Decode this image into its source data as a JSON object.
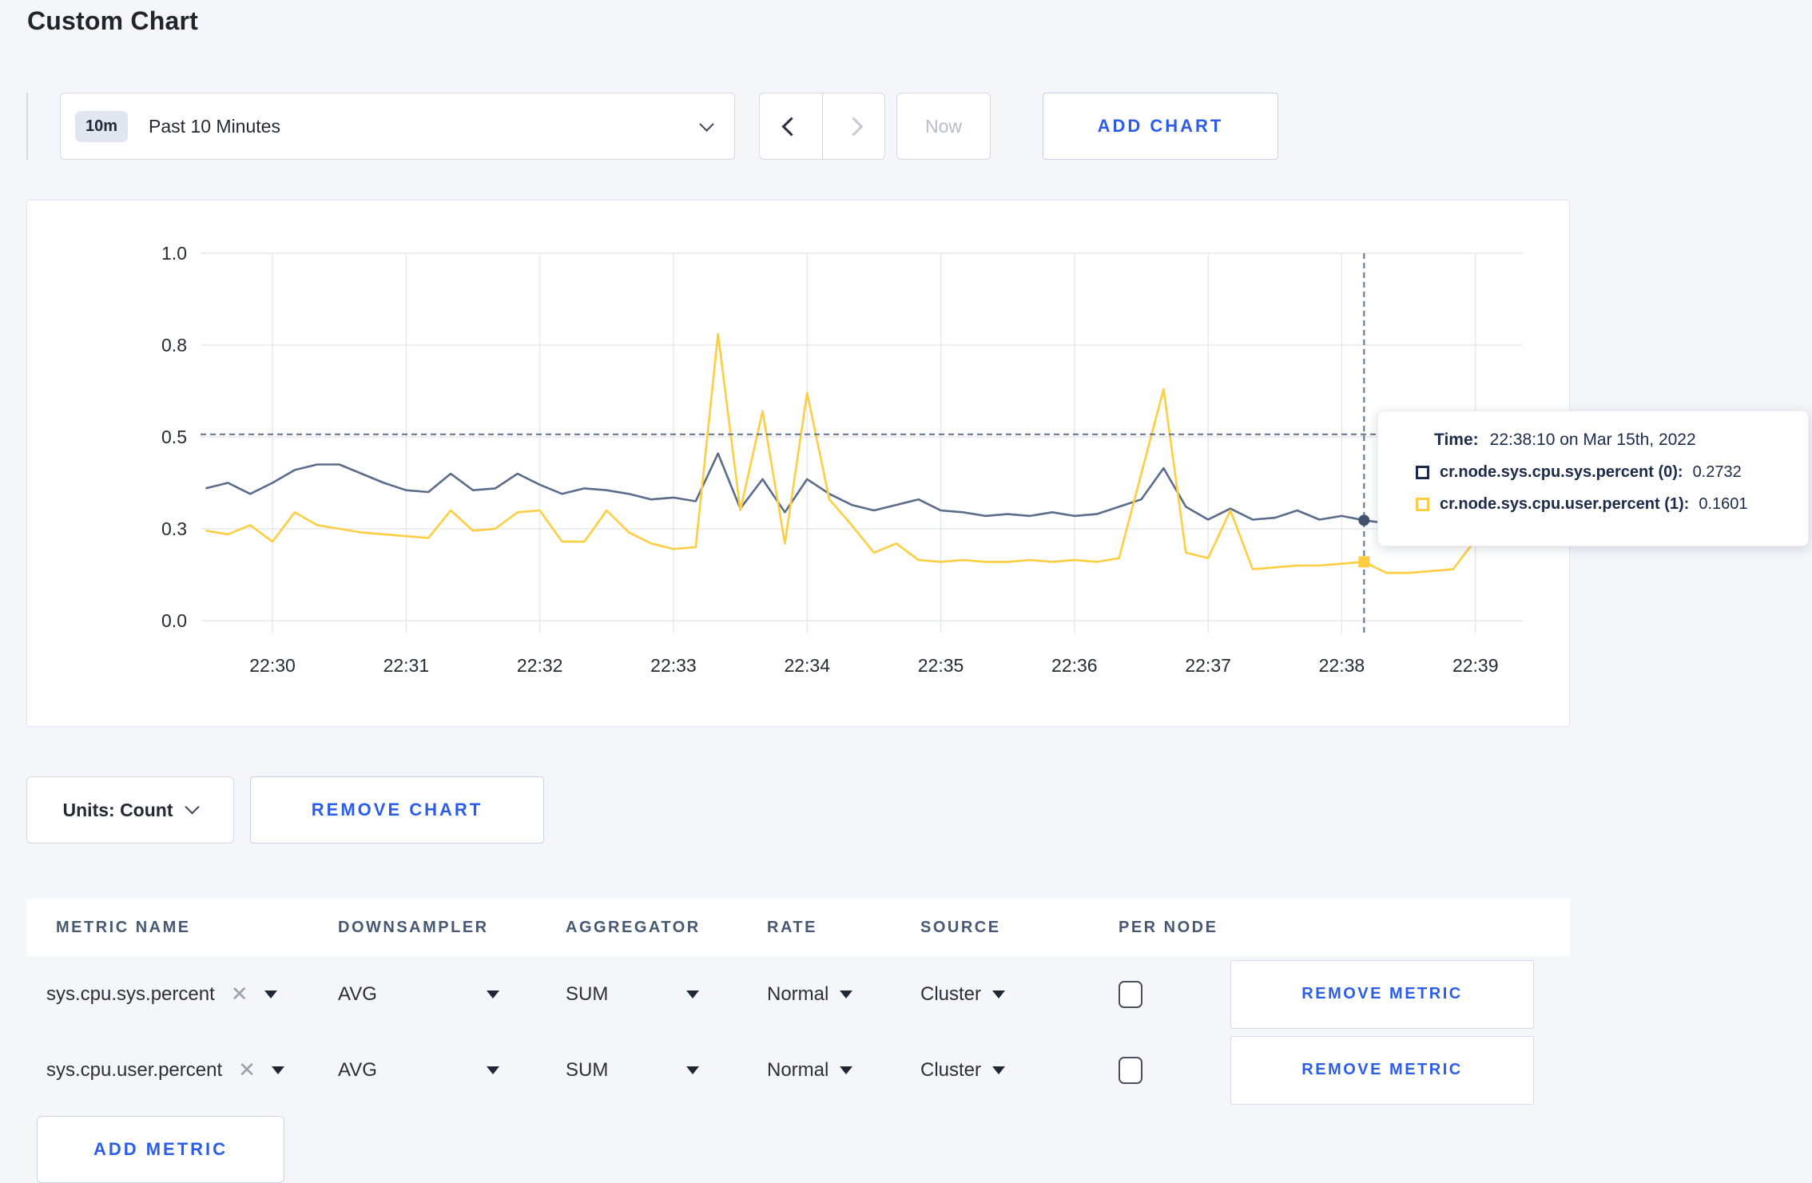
{
  "page": {
    "title": "Custom Chart"
  },
  "toolbar": {
    "time_badge": "10m",
    "time_label": "Past 10 Minutes",
    "now_label": "Now",
    "add_chart_label": "ADD CHART"
  },
  "chart_data": {
    "type": "line",
    "x_ticks": [
      "22:30",
      "22:31",
      "22:32",
      "22:33",
      "22:34",
      "22:35",
      "22:36",
      "22:37",
      "22:38",
      "22:39"
    ],
    "y_tick_labels": [
      "0.0",
      "0.3",
      "0.5",
      "0.8",
      "1.0"
    ],
    "y_tick_values": [
      0,
      0.25,
      0.5,
      0.75,
      1.0
    ],
    "ylim": [
      0,
      1
    ],
    "x_start": "22:29:30",
    "x_step_seconds": 10,
    "grid": true,
    "series": [
      {
        "name": "cr.node.sys.cpu.sys.percent",
        "color": "#5b6c8a",
        "values": [
          0.36,
          0.375,
          0.345,
          0.375,
          0.41,
          0.425,
          0.425,
          0.4,
          0.375,
          0.355,
          0.35,
          0.4,
          0.355,
          0.36,
          0.4,
          0.37,
          0.345,
          0.36,
          0.355,
          0.345,
          0.33,
          0.335,
          0.325,
          0.455,
          0.305,
          0.385,
          0.295,
          0.385,
          0.345,
          0.315,
          0.3,
          0.315,
          0.33,
          0.3,
          0.295,
          0.285,
          0.29,
          0.285,
          0.295,
          0.285,
          0.29,
          0.31,
          0.33,
          0.415,
          0.31,
          0.275,
          0.305,
          0.275,
          0.28,
          0.3,
          0.275,
          0.285,
          0.2732,
          0.265,
          0.27,
          0.28,
          0.285,
          0.29,
          0.295,
          0.3
        ]
      },
      {
        "name": "cr.node.sys.cpu.user.percent",
        "color": "#ffcd40",
        "values": [
          0.245,
          0.235,
          0.26,
          0.215,
          0.295,
          0.26,
          0.25,
          0.24,
          0.235,
          0.23,
          0.225,
          0.3,
          0.245,
          0.25,
          0.295,
          0.3,
          0.215,
          0.215,
          0.3,
          0.24,
          0.21,
          0.195,
          0.2,
          0.78,
          0.3,
          0.57,
          0.21,
          0.62,
          0.33,
          0.26,
          0.185,
          0.21,
          0.165,
          0.16,
          0.165,
          0.16,
          0.16,
          0.165,
          0.16,
          0.165,
          0.16,
          0.17,
          0.4,
          0.63,
          0.185,
          0.17,
          0.3,
          0.14,
          0.145,
          0.15,
          0.15,
          0.155,
          0.1601,
          0.13,
          0.13,
          0.135,
          0.14,
          0.22,
          0.28,
          0.24
        ]
      }
    ],
    "crosshair": {
      "index": 52,
      "h_value": 0.507,
      "color": "#5b7292"
    },
    "tooltip": {
      "time_label": "Time:",
      "time_value": "22:38:10 on Mar 15th, 2022",
      "entries": [
        {
          "label": "cr.node.sys.cpu.sys.percent (0):",
          "value": "0.2732",
          "square_color": "#1c2b4a"
        },
        {
          "label": "cr.node.sys.cpu.user.percent (1):",
          "value": "0.1601",
          "square_color": "#ffcd40"
        }
      ]
    }
  },
  "chart_footer": {
    "units_label": "Units: Count",
    "remove_chart_label": "REMOVE CHART"
  },
  "metrics_table": {
    "headers": [
      "METRIC NAME",
      "DOWNSAMPLER",
      "AGGREGATOR",
      "RATE",
      "SOURCE",
      "PER NODE"
    ],
    "rows": [
      {
        "metric": "sys.cpu.sys.percent",
        "downsampler": "AVG",
        "aggregator": "SUM",
        "rate": "Normal",
        "source": "Cluster",
        "per_node_checked": false,
        "remove_label": "REMOVE METRIC"
      },
      {
        "metric": "sys.cpu.user.percent",
        "downsampler": "AVG",
        "aggregator": "SUM",
        "rate": "Normal",
        "source": "Cluster",
        "per_node_checked": false,
        "remove_label": "REMOVE METRIC"
      }
    ],
    "add_metric_label": "ADD METRIC"
  }
}
